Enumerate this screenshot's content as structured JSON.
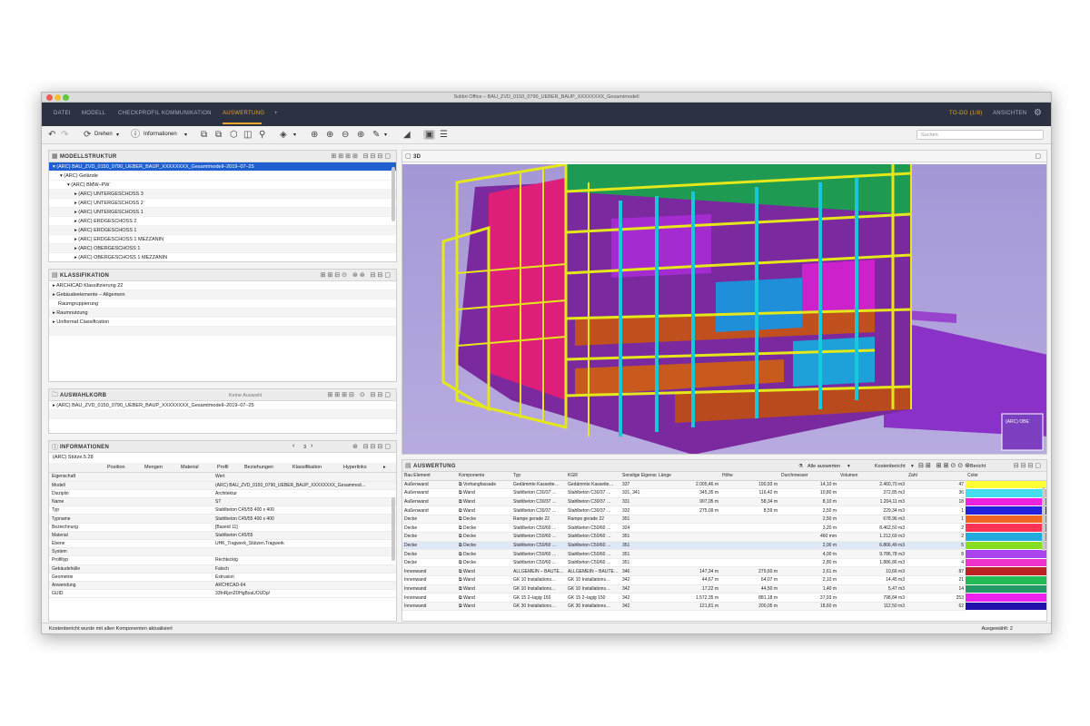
{
  "window": {
    "title": "Solibri Office – BAU_ZVD_0150_0790_UEBER_BAUP_XXXXXXXX_Gesamtmodell"
  },
  "menu": {
    "items": [
      "DATEI",
      "MODELL",
      "CHECKPROFIL",
      "KOMMUNIKATION",
      "AUSWERTUNG",
      "+"
    ],
    "active": "AUSWERTUNG",
    "todo": "TO-DO (1/8)",
    "views": "ANSICHTEN"
  },
  "toolbar": {
    "rotate_label": "Drehen",
    "info_label": "Informationen",
    "search_placeholder": "Suchen"
  },
  "model_tree": {
    "title": "MODELLSTRUKTUR",
    "rows": [
      "▾ (ARC) BAU_ZVD_0150_0790_UEBER_BAUP_XXXXXXXX_Gesamtmodell–2019–07–25",
      "▾ (ARC) Gelände",
      "▾ (ARC) BMW–PW",
      "▸ (ARC) UNTERGESCHOSS 3",
      "▸ (ARC) UNTERGESCHOSS 2",
      "▸ (ARC) UNTERGESCHOSS 1",
      "▸ (ARC) ERDGESCHOSS 2",
      "▸ (ARC) ERDGESCHOSS 1",
      "▸ (ARC) ERDGESCHOSS 1 MEZZANIN",
      "▸ (ARC) OBERGESCHOSS 1",
      "▸ (ARC) OBERGESCHOSS 1 MEZZANIN"
    ]
  },
  "classification": {
    "title": "KLASSIFIKATION",
    "rows": [
      "▸ ARCHICAD Klassifizierung 22",
      "▸ Gebäudeelemente – Allgemein",
      "Raumgruppierung",
      "▸ Raumnutzung",
      "▸ Uniformat Classification"
    ]
  },
  "basket": {
    "title": "AUSWAHLKORB",
    "filter": "Keine Auswahl",
    "rows": [
      "▸ (ARC) BAU_ZVD_0150_0790_UEBER_BAUP_XXXXXXXX_Gesamtmodell–2019–07–25"
    ]
  },
  "info": {
    "title": "INFORMATIONEN",
    "page": "3",
    "element": "(ARC) Stütze.5.28",
    "tabs": [
      "Position",
      "Mengen",
      "Material",
      "Profil",
      "Beziehungen",
      "Klassifikation",
      "Hyperlinks"
    ],
    "headers": [
      "Eigenschaft",
      "Wert"
    ],
    "rows": [
      [
        "Modell",
        "(ARC) BAU_ZVD_0150_0790_UEBER_BAUP_XXXXXXXX_Gesammod…"
      ],
      [
        "Disziplin",
        "Architektur"
      ],
      [
        "Name",
        "ST"
      ],
      [
        "Typ",
        "Stahlbeton C45/55 400 x 400"
      ],
      [
        "Typname",
        "Stahlbeton C45/55 400 x 400"
      ],
      [
        "Bezeichnung",
        "[Baseid 11]"
      ],
      [
        "Material",
        "Stahlbeton C45/55"
      ],
      [
        "Ebene",
        "UHK_Tragwerk_Stützen.Tragwerk"
      ],
      [
        "System",
        ""
      ],
      [
        "Profiltyp",
        "Rechteckig"
      ],
      [
        "Gebäudehülle",
        "Falsch"
      ],
      [
        "Geometrie",
        "Extrusion"
      ],
      [
        "Anwendung",
        "ARCHICAD-64"
      ],
      [
        "GUID",
        "33fnRjzn2DHgBxaUOUDp/"
      ]
    ]
  },
  "viewer": {
    "title": "3D",
    "nav_label": "(ARC) OBE"
  },
  "report": {
    "title": "AUSWERTUNG",
    "evaluate_label": "Alle auswerten",
    "cost_label": "Kostenbericht",
    "report_label": "Bericht",
    "headers": [
      "Bau Element",
      "Komponente",
      "Typ",
      "KGR",
      "Sonstige Eigenschaften KGR",
      "Länge",
      "Höhe",
      "Durchmesser",
      "Volumen",
      "Zahl",
      "Color"
    ],
    "rows": [
      [
        "Außenwand",
        "Vorhangfassade",
        "Gedämmte Kassette…",
        "Gedämmte Kassette…",
        "337",
        "2.005,46 m",
        "190,93 m",
        "14,10 m",
        "2.460,70 m3",
        "47",
        "#ffff33"
      ],
      [
        "Außenwand",
        "Wand",
        "Stahlbeton C30/37 …",
        "Stahlbeton C30/37 …",
        "331, 341",
        "345,35 m",
        "116,42 m",
        "10,80 m",
        "372,85 m3",
        "36",
        "#44ddee"
      ],
      [
        "Außenwand",
        "Wand",
        "Stahlbeton C30/37 …",
        "Stahlbeton C30/37 …",
        "331",
        "907,05 m",
        "58,34 m",
        "8,10 m",
        "1.204,11 m3",
        "18",
        "#ee22dd"
      ],
      [
        "Außenwand",
        "Wand",
        "Stahlbeton C30/37 …",
        "Stahlbeton C30/37 …",
        "332",
        "275,09 m",
        "8,59 m",
        "2,50 m",
        "229,34 m3",
        "1",
        "#2222dd"
      ],
      [
        "Decke",
        "Decke",
        "Rampe gerade 22",
        "Rampe gerade 22",
        "351",
        "",
        "",
        "2,50 m",
        "678,96 m3",
        "1",
        "#ee6622"
      ],
      [
        "Decke",
        "Decke",
        "Stahlbeton C50/60 …",
        "Stahlbeton C50/60 …",
        "324",
        "",
        "",
        "3,20 m",
        "8.462,50 m3",
        "2",
        "#ff3355"
      ],
      [
        "Decke",
        "Decke",
        "Stahlbeton C50/60 …",
        "Stahlbeton C50/60 …",
        "351",
        "",
        "",
        "460 mm",
        "1.212,69 m3",
        "2",
        "#22aadd"
      ],
      [
        "Decke",
        "Decke",
        "Stahlbeton C50/60 …",
        "Stahlbeton C50/60 …",
        "351",
        "",
        "",
        "2,00 m",
        "6.866,49 m3",
        "5",
        "#88dd22"
      ],
      [
        "Decke",
        "Decke",
        "Stahlbeton C50/60 …",
        "Stahlbeton C50/60 …",
        "351",
        "",
        "",
        "4,00 m",
        "9.786,78 m3",
        "8",
        "#aa44ee"
      ],
      [
        "Decke",
        "Decke",
        "Stahlbeton C50/60 …",
        "Stahlbeton C50/60 …",
        "351",
        "",
        "",
        "2,80 m",
        "1.886,86 m3",
        "4",
        "#ee33cc"
      ],
      [
        "Innenwand",
        "Wand",
        "ALLGEMEIN – BAUTE…",
        "ALLGEMEIN – BAUTE…",
        "346",
        "147,34 m",
        "279,60 m",
        "2,61 m",
        "10,66 m3",
        "87",
        "#bb2222"
      ],
      [
        "Innenwand",
        "Wand",
        "GK 10 Installations…",
        "GK 10 Installations…",
        "342",
        "44,67 m",
        "64,07 m",
        "2,10 m",
        "14,45 m3",
        "21",
        "#22bb55"
      ],
      [
        "Innenwand",
        "Wand",
        "GK 10 Installations…",
        "GK 10 Installations…",
        "342",
        "17,22 m",
        "44,50 m",
        "1,40 m",
        "5,47 m3",
        "14",
        "#229966"
      ],
      [
        "Innenwand",
        "Wand",
        "GK 15 2–lagig 150",
        "GK 15 2–lagig 150",
        "342",
        "1.572,35 m",
        "881,18 m",
        "37,93 m",
        "798,84 m3",
        "253",
        "#ee22ee"
      ],
      [
        "Innenwand",
        "Wand",
        "GK 30 Installations…",
        "GK 30 Installations…",
        "342",
        "121,81 m",
        "200,05 m",
        "18,60 m",
        "112,50 m3",
        "62",
        "#2211aa"
      ]
    ]
  },
  "status": {
    "message": "Kostenbericht wurde mit allen Komponenten aktualisiert",
    "selection": "Ausgewählt: 2"
  }
}
